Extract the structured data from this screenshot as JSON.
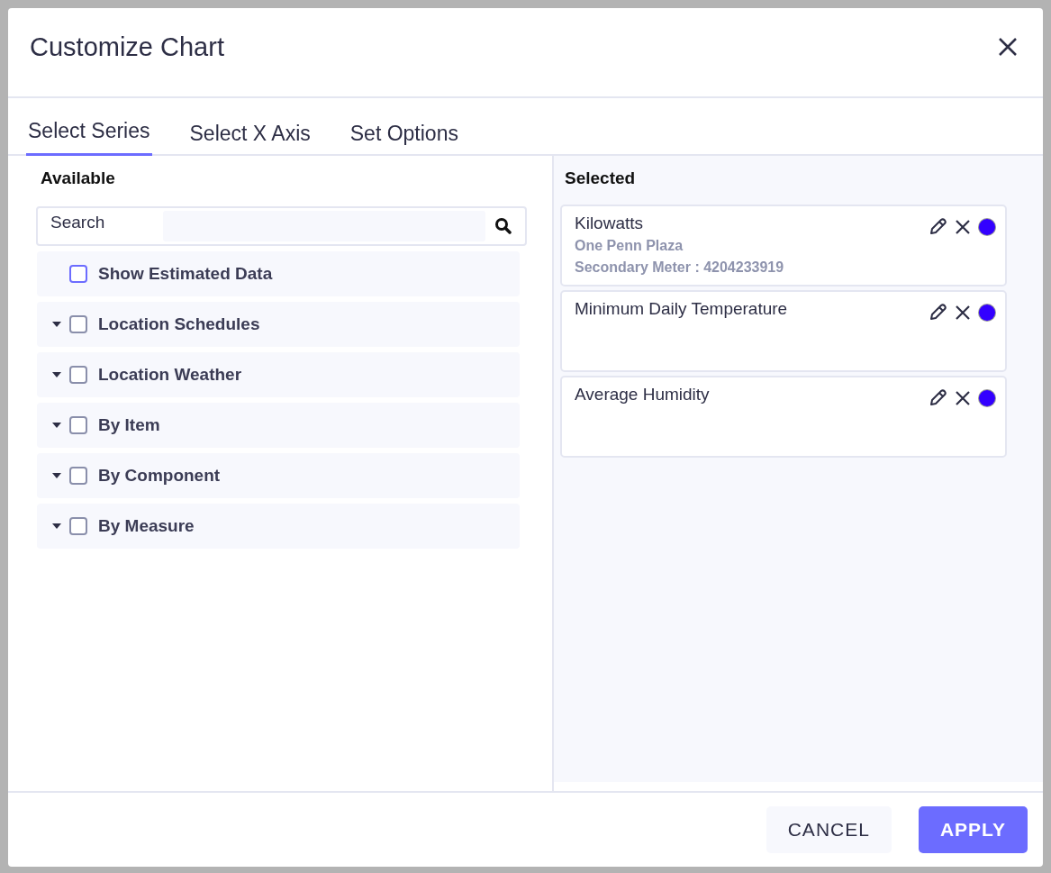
{
  "dialog": {
    "title": "Customize Chart"
  },
  "tabs": [
    {
      "label": "Select Series",
      "selected": true
    },
    {
      "label": "Select X Axis",
      "selected": false
    },
    {
      "label": "Set Options",
      "selected": false
    }
  ],
  "available": {
    "heading": "Available",
    "search": {
      "label": "Search"
    },
    "options": [
      {
        "kind": "checkbox",
        "label": "Show Estimated Data",
        "checked": false
      },
      {
        "kind": "group",
        "label": "Location Schedules",
        "checked": false
      },
      {
        "kind": "group",
        "label": "Location Weather",
        "checked": false
      },
      {
        "kind": "group",
        "label": "By Item",
        "checked": false
      },
      {
        "kind": "group",
        "label": "By Component",
        "checked": false
      },
      {
        "kind": "group",
        "label": "By Measure",
        "checked": false
      }
    ]
  },
  "selected": {
    "heading": "Selected",
    "series": [
      {
        "name": "Kilowatts",
        "details": [
          "One Penn Plaza",
          "Secondary Meter : 4204233919"
        ],
        "color": "#3300ff"
      },
      {
        "name": "Minimum Daily Temperature",
        "color": "#3300ff"
      },
      {
        "name": "Average Humidity",
        "color": "#3300ff"
      }
    ]
  },
  "buttons": [
    {
      "kind": "secondary",
      "label": "CANCEL"
    },
    {
      "kind": "primary",
      "label": "APPLY"
    }
  ]
}
